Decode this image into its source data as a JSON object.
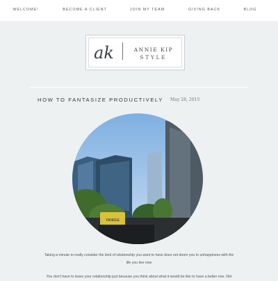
{
  "nav": {
    "items": [
      {
        "label": "WELCOME!"
      },
      {
        "label": "BECOME A CLIENT"
      },
      {
        "label": "JOIN MY TEAM"
      },
      {
        "label": "GIVING BACK"
      },
      {
        "label": "BLOG"
      }
    ]
  },
  "logo": {
    "monogram": "ak",
    "name": "ANNIE KIP",
    "subtitle": "STYLE"
  },
  "post": {
    "title": "HOW TO FANTASIZE PRODUCTIVELY",
    "date": "May 28, 2015",
    "image_sign_text": "YANKEE",
    "paragraph1_line1": "Taking a minute to really consider the kind of relationship you want to have does not doom you to unhappiness with the",
    "paragraph1_line2": "life you live now",
    "paragraph2_line1": "You don't have to leave your relationship just because you think about what it would be like to have a better one. Not"
  },
  "colors": {
    "page_background": "#eef1f1",
    "nav_background": "#ffffff",
    "text_dark": "#2f3538"
  }
}
